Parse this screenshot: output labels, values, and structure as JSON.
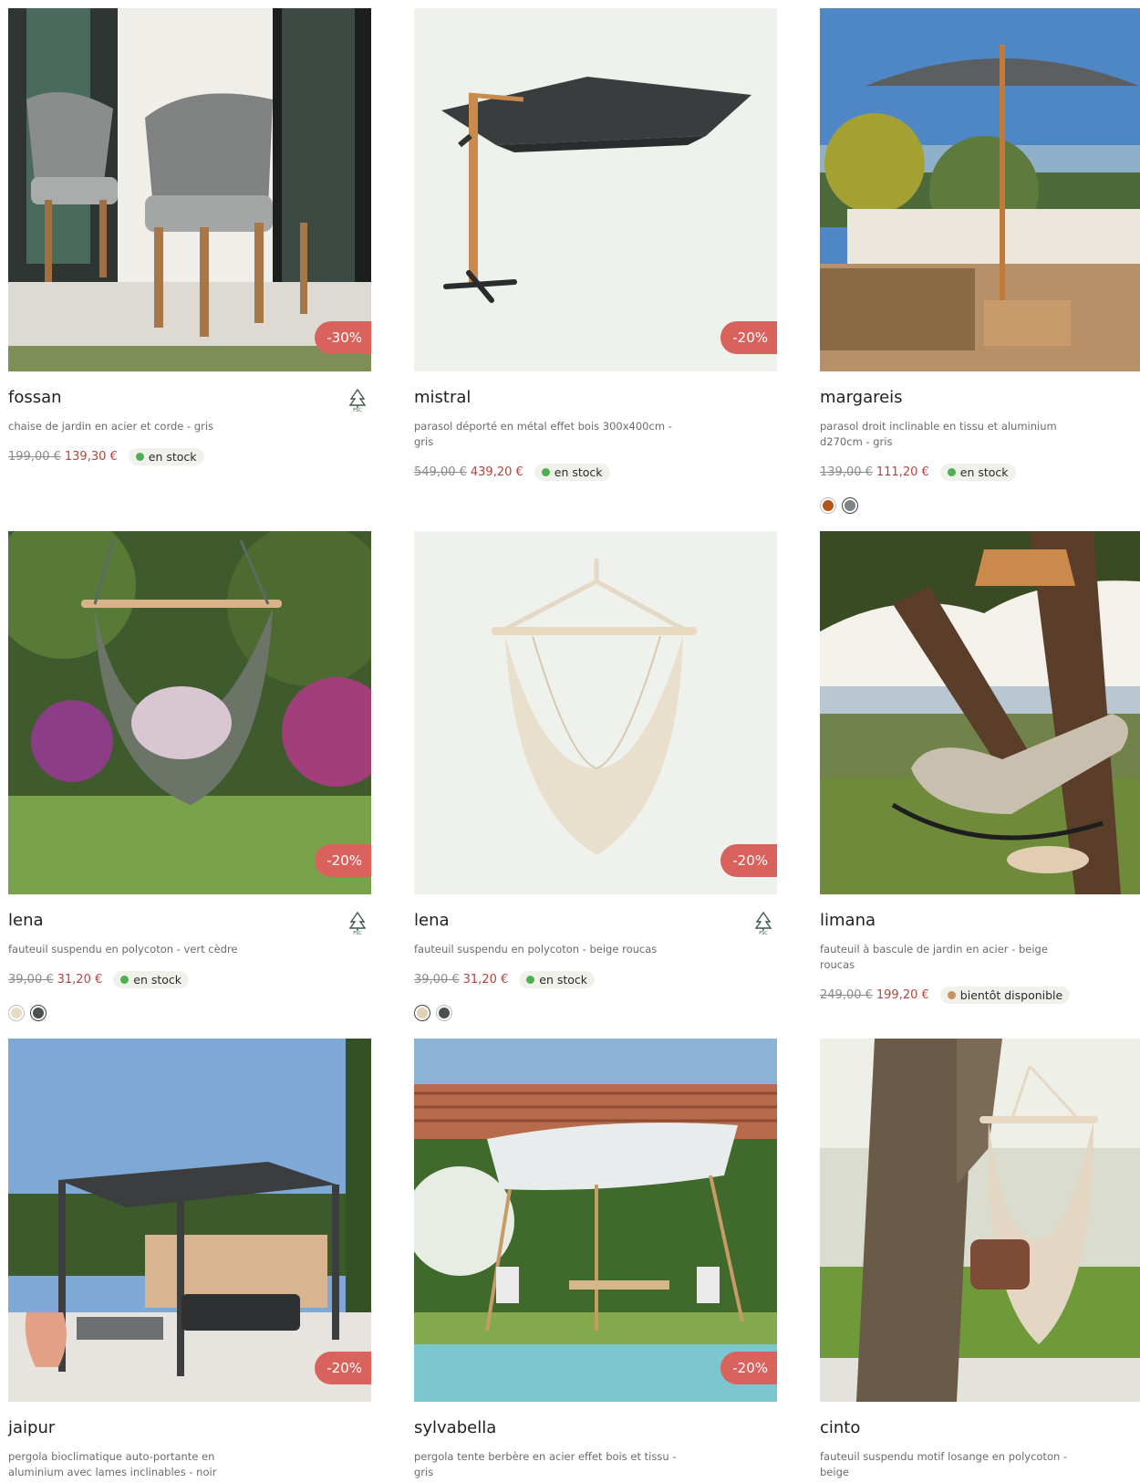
{
  "products": [
    {
      "title": "fossan",
      "description": "chaise de jardin en acier et corde - gris",
      "old_price": "199,00 €",
      "new_price": "139,30 €",
      "stock": "en stock",
      "stock_color": "#4caf50",
      "discount": "-30%",
      "fsc": true,
      "swatches": []
    },
    {
      "title": "mistral",
      "description": "parasol déporté en métal effet bois 300x400cm - gris",
      "old_price": "549,00 €",
      "new_price": "439,20 €",
      "stock": "en stock",
      "stock_color": "#4caf50",
      "discount": "-20%",
      "fsc": false,
      "swatches": []
    },
    {
      "title": "margareis",
      "description": "parasol droit inclinable en tissu et aluminium d270cm - gris",
      "old_price": "139,00 €",
      "new_price": "111,20 €",
      "stock": "en stock",
      "stock_color": "#4caf50",
      "discount": "",
      "fsc": false,
      "swatches": [
        "#b4541d",
        "#7d8587"
      ]
    },
    {
      "title": "lena",
      "description": "fauteuil suspendu en polycoton - vert cèdre",
      "old_price": "39,00 €",
      "new_price": "31,20 €",
      "stock": "en stock",
      "stock_color": "#4caf50",
      "discount": "-20%",
      "fsc": true,
      "swatches": [
        "#e6dcc4",
        "#4b514d"
      ]
    },
    {
      "title": "lena",
      "description": "fauteuil suspendu en polycoton - beige roucas",
      "old_price": "39,00 €",
      "new_price": "31,20 €",
      "stock": "en stock",
      "stock_color": "#4caf50",
      "discount": "-20%",
      "fsc": true,
      "swatches": [
        "#e0d3b5",
        "#4b514d"
      ]
    },
    {
      "title": "limana",
      "description": "fauteuil à bascule de jardin en acier - beige roucas",
      "old_price": "249,00 €",
      "new_price": "199,20 €",
      "stock": "bientôt disponible",
      "stock_color": "#c9925c",
      "discount": "",
      "fsc": false,
      "swatches": []
    },
    {
      "title": "jaipur",
      "description": "pergola bioclimatique auto-portante en aluminium avec lames inclinables - noir",
      "discount": "-20%"
    },
    {
      "title": "sylvabella",
      "description": "pergola tente berbère en acier effet bois et tissu - gris",
      "discount": "-20%"
    },
    {
      "title": "cinto",
      "description": "fauteuil suspendu motif losange en polycoton - beige",
      "discount": ""
    }
  ],
  "icons": {
    "fsc": "fsc-tree-icon"
  },
  "colors": {
    "badge": "#d9625c",
    "sale_price": "#b8433d",
    "in_stock": "#4caf50",
    "coming_soon": "#c9925c"
  }
}
